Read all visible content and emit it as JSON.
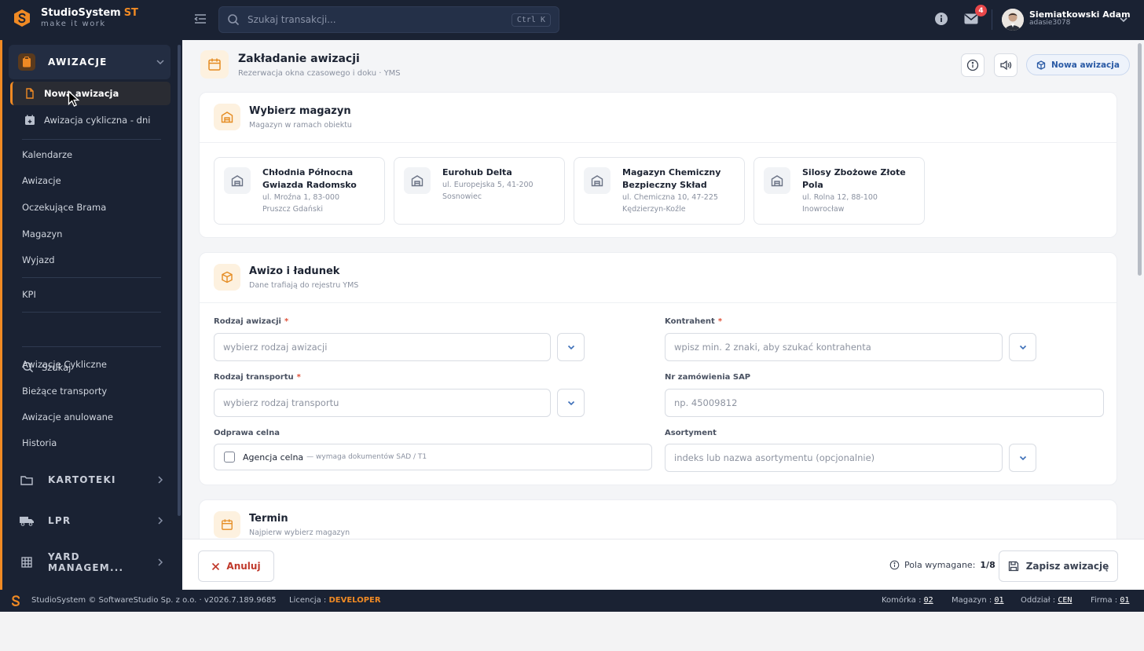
{
  "brand": {
    "name": "StudioSystem",
    "suffix": "ST",
    "tagline": "make it work"
  },
  "search": {
    "placeholder": "Szukaj transakcji...",
    "shortcut": "Ctrl K"
  },
  "notifications": {
    "count": "4"
  },
  "user": {
    "name": "Siemiatkowski Adam",
    "login": "adasie3078"
  },
  "sidebar": {
    "section_awizacje": "AWIZACJE",
    "sub_items": [
      {
        "label": "Nowa awizacja",
        "icon": "document-icon"
      },
      {
        "label": "Awizacja cykliczna - dni",
        "icon": "calendar-plus-icon"
      }
    ],
    "items_a": [
      "Kalendarze",
      "Awizacje",
      "Oczekujące Brama",
      "Magazyn",
      "Wyjazd"
    ],
    "kpi": "KPI",
    "search_label": "Szukaj",
    "items_b": [
      "Awizacje Cykliczne",
      "Bieżące transporty",
      "Awizacje anulowane",
      "Historia"
    ],
    "section_kartoteki": "KARTOTEKI",
    "section_lpr": "LPR",
    "section_yard": "YARD MANAGEM..."
  },
  "page": {
    "title": "Zakładanie awizacji",
    "subtitle": "Rezerwacja okna czasowego i doku · YMS",
    "new_button": "Nowa awizacja"
  },
  "warehouse_card": {
    "title": "Wybierz magazyn",
    "subtitle": "Magazyn w ramach obiektu",
    "warehouses": [
      {
        "name": "Chłodnia Północna Gwiazda Radomsko",
        "addr1": "ul. Mroźna 1, 83-000",
        "addr2": "Pruszcz Gdański"
      },
      {
        "name": "Eurohub Delta",
        "addr1": "ul. Europejska 5, 41-200",
        "addr2": "Sosnowiec"
      },
      {
        "name": "Magazyn Chemiczny Bezpieczny Skład",
        "addr1": "ul. Chemiczna 10, 47-225",
        "addr2": "Kędzierzyn-Koźle"
      },
      {
        "name": "Silosy Zbożowe Złote Pola",
        "addr1": "ul. Rolna 12, 88-100",
        "addr2": "Inowrocław"
      }
    ]
  },
  "cargo_card": {
    "title": "Awizo i ładunek",
    "subtitle": "Dane trafiają do rejestru YMS",
    "rodzaj_awizacji_label": "Rodzaj awizacji",
    "rodzaj_awizacji_placeholder": "wybierz rodzaj awizacji",
    "kontrahent_label": "Kontrahent",
    "kontrahent_placeholder": "wpisz min. 2 znaki, aby szukać kontrahenta",
    "rodzaj_transportu_label": "Rodzaj transportu",
    "rodzaj_transportu_placeholder": "wybierz rodzaj transportu",
    "nr_sap_label": "Nr zamówienia SAP",
    "nr_sap_placeholder": "np. 45009812",
    "odprawa_label": "Odprawa celna",
    "agencja_label": "Agencja celna",
    "agencja_hint": "— wymaga dokumentów SAD / T1",
    "asortyment_label": "Asortyment",
    "asortyment_placeholder": "indeks lub nazwa asortymentu (opcjonalnie)",
    "required_mark": "*"
  },
  "term_card": {
    "title": "Termin",
    "subtitle": "Najpierw wybierz magazyn"
  },
  "bottom": {
    "cancel": "Anuluj",
    "required_label": "Pola wymagane:",
    "required_count": "1/8",
    "save": "Zapisz awizację"
  },
  "footer": {
    "copyright": "StudioSystem © SoftwareStudio Sp. z o.o. · v2026.7.189.9685",
    "license_label": "Licencja :",
    "license_value": "DEVELOPER",
    "komorka_label": "Komórka :",
    "komorka_value": "02",
    "magazyn_label": "Magazyn :",
    "magazyn_value": "01",
    "oddzial_label": "Oddział :",
    "oddzial_value": "CEN",
    "firma_label": "Firma :",
    "firma_value": "01"
  },
  "colors": {
    "accent": "#f08a24",
    "dark": "#1a2233",
    "link": "#2a5aa5"
  }
}
